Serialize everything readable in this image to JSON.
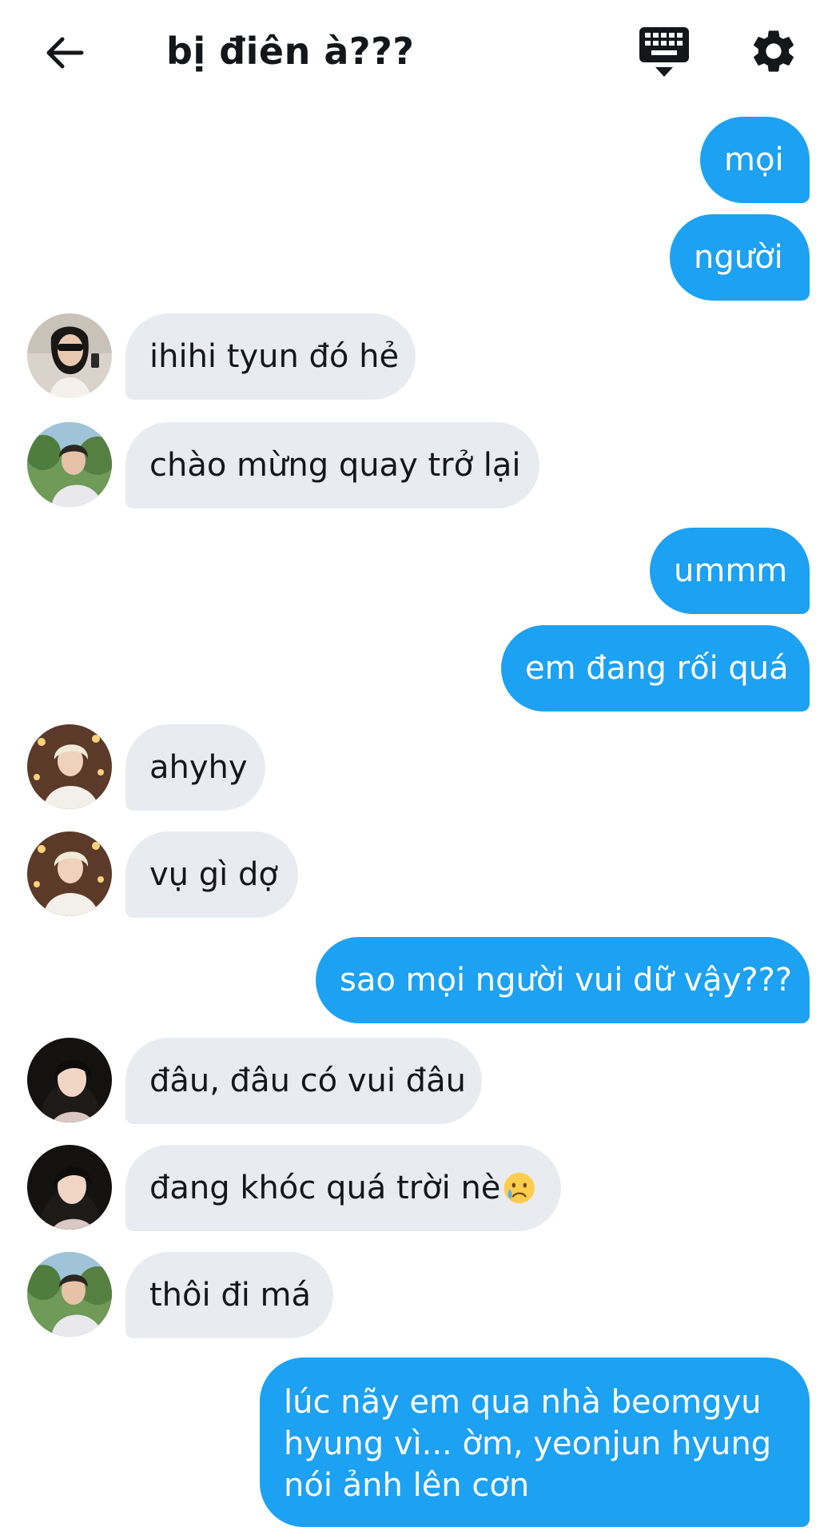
{
  "header": {
    "title": "bị điên à???",
    "back_icon": "arrow-left-icon",
    "keyboard_icon": "keyboard-icon",
    "settings_icon": "gear-icon"
  },
  "colors": {
    "outgoing_bubble": "#1da1f2",
    "incoming_bubble": "#e8ecf0",
    "text": "#14171a"
  },
  "messages": [
    {
      "from": "me",
      "text": "mọi"
    },
    {
      "from": "me",
      "text": "người"
    },
    {
      "from": "member-sunglasses",
      "text": "ihihi tyun đó hẻ"
    },
    {
      "from": "member-park",
      "text": "chào mừng quay trở lại"
    },
    {
      "from": "me",
      "text": "ummm"
    },
    {
      "from": "me",
      "text": "em đang rối quá"
    },
    {
      "from": "member-blonde",
      "text": "ahyhy"
    },
    {
      "from": "member-blonde",
      "text": "vụ gì dợ"
    },
    {
      "from": "me",
      "text": "sao mọi người vui dữ vậy???"
    },
    {
      "from": "member-darkhair",
      "text": "đâu, đâu có vui đâu"
    },
    {
      "from": "member-darkhair",
      "text": "đang khóc quá trời nè",
      "emoji": "crying-face-emoji"
    },
    {
      "from": "member-park",
      "text": "thôi đi má"
    },
    {
      "from": "me",
      "text": "lúc nãy em qua nhà beomgyu hyung vì... ờm, yeonjun hyung nói ảnh lên cơn"
    }
  ]
}
